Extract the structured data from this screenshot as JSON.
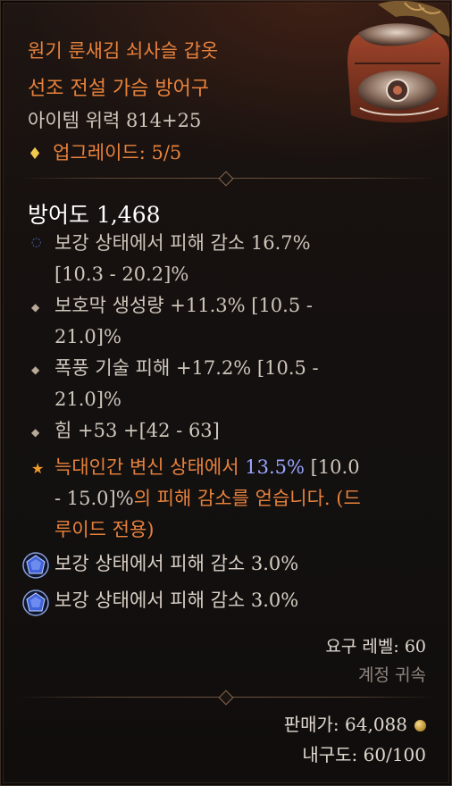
{
  "item": {
    "name": "원기 룬새김 쇠사슬 갑옷",
    "type": "선조 전설 가슴 방어구",
    "power": "아이템 위력 814+25",
    "upgrade": "업그레이드: 5/5"
  },
  "stats": {
    "armor": "방어도 1,468"
  },
  "affixes": [
    {
      "line1": "보강 상태에서 피해 감소 16.7%",
      "line2": "[10.3 - 20.2]%"
    },
    {
      "line1": "보호막 생성량 +11.3% [10.5 -",
      "line2": "21.0]%"
    },
    {
      "line1": "폭풍 기술 피해 +17.2% [10.5 -",
      "line2": "21.0]%"
    },
    {
      "line1": "힘 +53 +[42 - 63]",
      "line2": ""
    }
  ],
  "legendary": {
    "prefix": "늑대인간 변신 상태에서 ",
    "value": "13.5%",
    "range1": " [10.0",
    "line2_range": "- 15.0]%",
    "line2_text": "의 피해 감소를 얻습니다. (드",
    "line3": "루이드 전용)"
  },
  "gems": [
    {
      "text": "보강 상태에서 피해 감소 3.0%"
    },
    {
      "text": "보강 상태에서 피해 감소 3.0%"
    }
  ],
  "footer": {
    "req_level": "요구 레벨: 60",
    "bound": "계정 귀속",
    "sell_label": "판매가: ",
    "sell_value": "64,088",
    "durability_label": "내구도: ",
    "durability_value": "60/100"
  },
  "icons": {
    "upgrade": "diamond-icon",
    "affix_bullet": "small-diamond-icon",
    "affix_first_bullet": "ring-icon",
    "legendary_bullet": "star-icon",
    "gem_socket": "sapphire-socket-icon",
    "gold": "gold-coin-icon"
  },
  "colors": {
    "legendary_orange": "#e8823c",
    "highlight_blue": "#9aa6ff",
    "text_gray": "#cfc6bb",
    "bound_gray": "#8e867e"
  }
}
